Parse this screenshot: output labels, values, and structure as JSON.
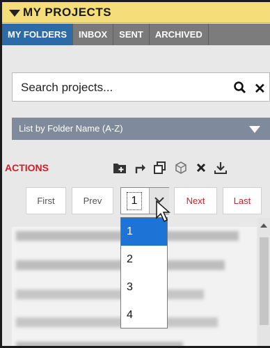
{
  "header": {
    "title": "MY PROJECTS"
  },
  "tabs": [
    {
      "label": "MY FOLDERS",
      "active": true
    },
    {
      "label": "INBOX",
      "active": false
    },
    {
      "label": "SENT",
      "active": false
    },
    {
      "label": "ARCHIVED",
      "active": false
    }
  ],
  "search": {
    "placeholder": "Search projects..."
  },
  "sort": {
    "label": "List by Folder Name (A-Z)"
  },
  "actions": {
    "label": "ACTIONS",
    "icons": [
      "new-folder-icon",
      "share-icon",
      "copy-icon",
      "box-icon",
      "delete-icon",
      "download-icon"
    ]
  },
  "pager": {
    "first": "First",
    "prev": "Prev",
    "current": "1",
    "next": "Next",
    "last": "Last",
    "options": [
      "1",
      "2",
      "3",
      "4"
    ]
  },
  "colors": {
    "header_bg": "#f5dd79",
    "tab_active": "#2d6aa8",
    "accent_red": "#c8202a",
    "selected_option": "#1e73d6"
  }
}
